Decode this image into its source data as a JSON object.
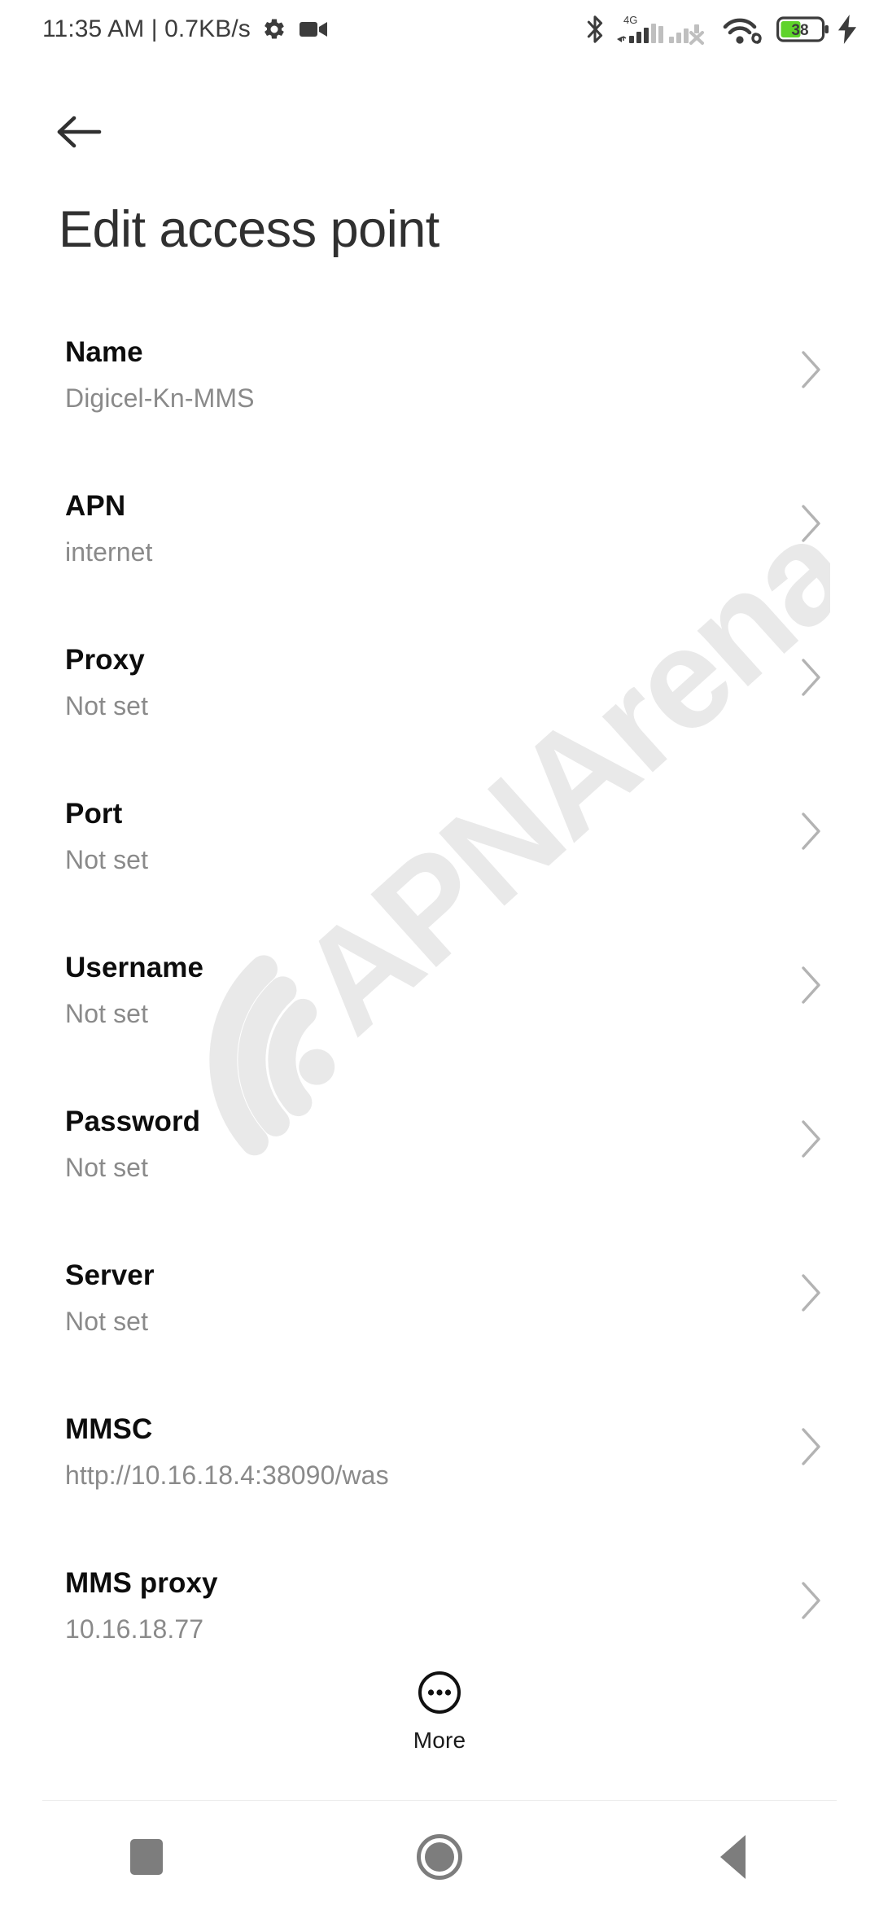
{
  "status_bar": {
    "clock_and_rate": "11:35 AM | 0.7KB/s",
    "icons": [
      "gear-icon",
      "video-camera-icon",
      "bluetooth-icon",
      "signal-4g-icon",
      "signal-sim2-off-icon",
      "wifi-icon",
      "battery-icon",
      "charging-bolt-icon"
    ],
    "network_label": "4G",
    "battery_percent": "38",
    "battery_fill_color": "#5ed32a"
  },
  "nav": {
    "back_label": "Back"
  },
  "header": {
    "title": "Edit access point"
  },
  "watermark": {
    "text": "APNArena",
    "color": "#e9e9e9"
  },
  "list": {
    "rows": [
      {
        "title": "Name",
        "value": "Digicel-Kn-MMS"
      },
      {
        "title": "APN",
        "value": "internet"
      },
      {
        "title": "Proxy",
        "value": "Not set"
      },
      {
        "title": "Port",
        "value": "Not set"
      },
      {
        "title": "Username",
        "value": "Not set"
      },
      {
        "title": "Password",
        "value": "Not set"
      },
      {
        "title": "Server",
        "value": "Not set"
      },
      {
        "title": "MMSC",
        "value": "http://10.16.18.4:38090/was"
      },
      {
        "title": "MMS proxy",
        "value": "10.16.18.77"
      }
    ]
  },
  "more_button": {
    "label": "More"
  },
  "system_nav": {
    "recents_label": "Recents",
    "home_label": "Home",
    "back_label": "Back"
  }
}
